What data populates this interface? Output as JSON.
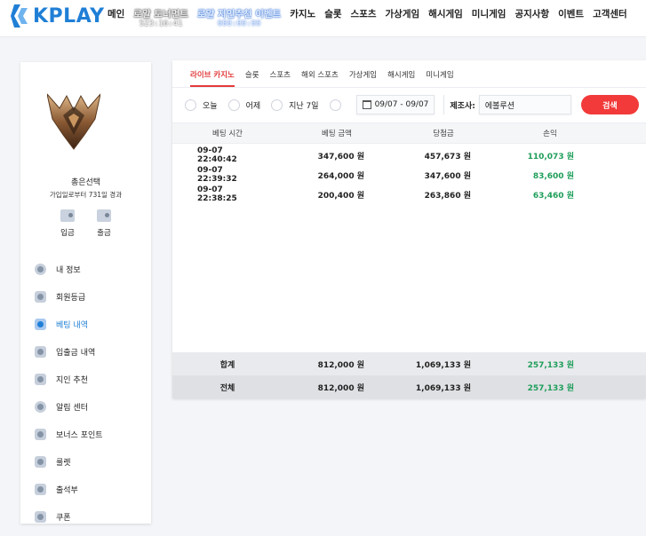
{
  "header": {
    "logo_text": "KPLAY",
    "nav": [
      {
        "label": "메인"
      },
      {
        "label": "로얄 토너먼트",
        "sub": "523:16:41"
      },
      {
        "label": "로얄 지인추천 이벤트",
        "sub": "000:00:00"
      },
      {
        "label": "카지노"
      },
      {
        "label": "슬롯"
      },
      {
        "label": "스포츠"
      },
      {
        "label": "가상게임"
      },
      {
        "label": "해시게임"
      },
      {
        "label": "미니게임"
      },
      {
        "label": "공지사항"
      },
      {
        "label": "이벤트"
      },
      {
        "label": "고객센터"
      }
    ]
  },
  "profile": {
    "rank_name": "총은선택",
    "join_info": "가입일로부터 731일 경과",
    "deposit_label": "입금",
    "withdraw_label": "출금"
  },
  "sidebar": {
    "items": [
      {
        "label": "내 정보",
        "icon": "user-icon"
      },
      {
        "label": "회원등급",
        "icon": "badge-icon"
      },
      {
        "label": "베팅 내역",
        "icon": "edit-icon",
        "active": true
      },
      {
        "label": "입출금 내역",
        "icon": "wallet-icon"
      },
      {
        "label": "지인 추천",
        "icon": "heart-icon"
      },
      {
        "label": "알림 센터",
        "icon": "message-icon"
      },
      {
        "label": "보너스 포인트",
        "icon": "wallet-icon"
      },
      {
        "label": "룰렛",
        "icon": "roulette-icon"
      },
      {
        "label": "출석부",
        "icon": "calendar-check-icon"
      },
      {
        "label": "쿠폰",
        "icon": "coupon-icon"
      }
    ]
  },
  "tabs": [
    {
      "label": "라이브 카지노",
      "active": true
    },
    {
      "label": "슬롯"
    },
    {
      "label": "스포츠"
    },
    {
      "label": "해외 스포츠"
    },
    {
      "label": "가상게임"
    },
    {
      "label": "해시게임"
    },
    {
      "label": "미니게임"
    }
  ],
  "filters": {
    "today": "오늘",
    "yesterday": "어제",
    "last7": "지난 7일",
    "date_range": "09/07 - 09/07",
    "maker_label": "제조사:",
    "maker_value": "에볼루션",
    "search_label": "검색"
  },
  "table": {
    "headers": [
      "베팅 시간",
      "베팅 금액",
      "당첨금",
      "손익"
    ],
    "rows": [
      {
        "time": "09-07 22:40:42",
        "bet": "347,600 원",
        "win": "457,673 원",
        "profit": "110,073 원"
      },
      {
        "time": "09-07 22:39:32",
        "bet": "264,000 원",
        "win": "347,600 원",
        "profit": "83,600 원"
      },
      {
        "time": "09-07 22:38:25",
        "bet": "200,400 원",
        "win": "263,860 원",
        "profit": "63,460 원"
      }
    ],
    "subtotal": {
      "label": "합계",
      "bet": "812,000 원",
      "win": "1,069,133 원",
      "profit": "257,133 원"
    },
    "total": {
      "label": "전체",
      "bet": "812,000 원",
      "win": "1,069,133 원",
      "profit": "257,133 원"
    }
  },
  "colors": {
    "brand": "#1f7fd6",
    "accent": "#f23a3a",
    "profit": "#1e9e5a"
  }
}
